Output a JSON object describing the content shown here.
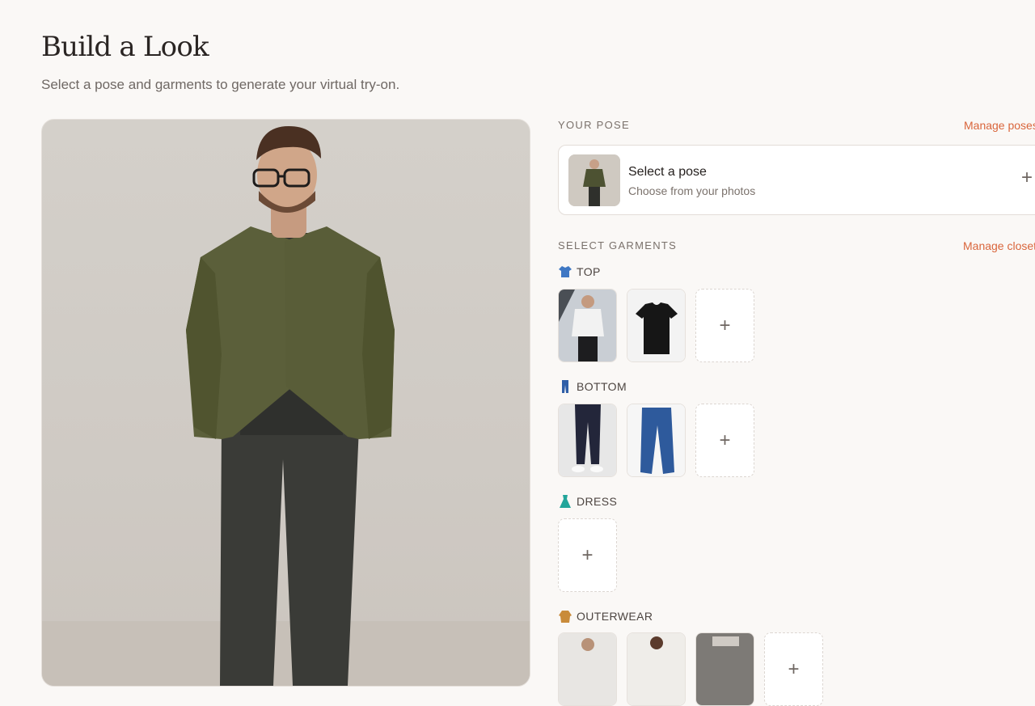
{
  "header": {
    "title": "Build a Look",
    "subtitle": "Select a pose and garments to generate your virtual try-on."
  },
  "pose": {
    "section_label": "YOUR POSE",
    "manage_link": "Manage poses",
    "card_title": "Select a pose",
    "card_subtitle": "Choose from your photos",
    "add_glyph": "+"
  },
  "garments": {
    "section_label": "SELECT GARMENTS",
    "manage_link": "Manage closet",
    "add_glyph": "+",
    "categories": [
      {
        "label": "TOP",
        "icon": "shirt-icon"
      },
      {
        "label": "BOTTOM",
        "icon": "jeans-icon"
      },
      {
        "label": "DRESS",
        "icon": "dress-icon"
      },
      {
        "label": "OUTERWEAR",
        "icon": "coat-icon"
      }
    ]
  },
  "colors": {
    "accent": "#d9653b",
    "background": "#faf8f6",
    "jacket": "#5b5f3a",
    "icon_blue": "#3f78c4",
    "icon_teal": "#23a59a"
  }
}
